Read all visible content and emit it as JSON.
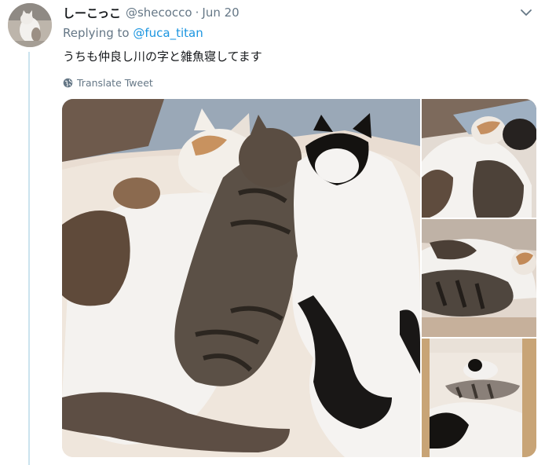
{
  "tweet": {
    "display_name": "しーこっこ",
    "handle": "@shecocco",
    "separator": "·",
    "date": "Jun 20",
    "replying_prefix": "Replying to ",
    "replying_to": "@fuca_titan",
    "text": "うちも仲良し川の字と雑魚寝してます",
    "translate_label": "Translate Tweet"
  },
  "icons": {
    "more": "chevron-down-icon",
    "translate": "globe-icon"
  },
  "colors": {
    "link": "#1b95e0",
    "secondary_text": "#657786",
    "thread_line": "#cbe3ee"
  },
  "media": {
    "photo_count": 4
  }
}
